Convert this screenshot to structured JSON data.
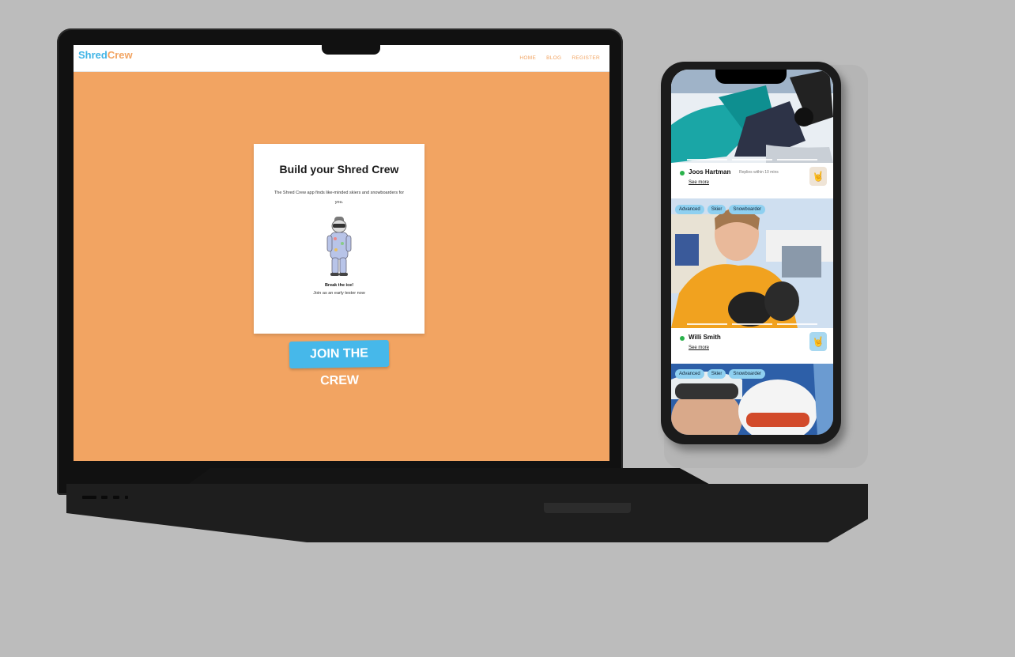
{
  "site": {
    "logo_part1": "Shred",
    "logo_part2": "Crew",
    "nav": [
      "HOME",
      "BLOG",
      "REGISTER"
    ]
  },
  "landing": {
    "title": "Build your Shred Crew",
    "subtitle": "The Shred Crew app finds like-minded skiers and snowboarders for you.",
    "tagline": "Break the ice!",
    "cta_text": "Join as an early tester now",
    "button": "JOIN THE CREW"
  },
  "phone": {
    "profiles": [
      {
        "name": "Joos Hartman",
        "reply": "Replies within 10 mins",
        "see_more": "See more",
        "status_color": "#2ab24b"
      },
      {
        "name": "Willi Smith",
        "see_more": "See more",
        "tags": [
          "Advanced",
          "Skier",
          "Snowboarder"
        ],
        "status_color": "#2ab24b"
      },
      {
        "tags": [
          "Advanced",
          "Skier",
          "Snowboarder"
        ]
      }
    ]
  },
  "colors": {
    "background": "#bcbcbc",
    "brand_orange": "#f2a462",
    "brand_blue": "#46b8ea",
    "tag_blue": "#8fd0f0"
  }
}
